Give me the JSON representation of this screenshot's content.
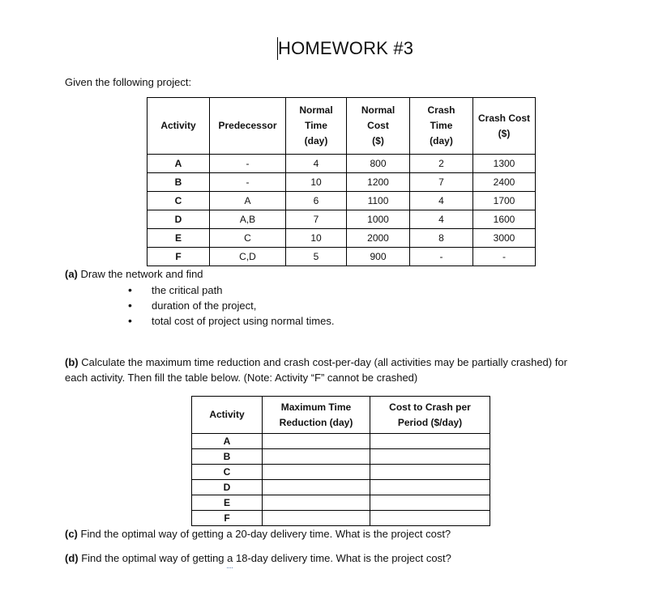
{
  "document": {
    "title": "HOMEWORK #3",
    "intro": "Given the following project:"
  },
  "project_table": {
    "headers": [
      "Activity",
      "Predecessor",
      "Normal Time (day)",
      "Normal Cost ($)",
      "Crash Time (day)",
      "Crash Cost ($)"
    ],
    "header_lines": [
      [
        "Activity"
      ],
      [
        "Predecessor"
      ],
      [
        "Normal",
        "Time",
        "(day)"
      ],
      [
        "Normal",
        "Cost",
        "($)"
      ],
      [
        "Crash",
        "Time",
        "(day)"
      ],
      [
        "Crash Cost",
        "($)"
      ]
    ],
    "rows": [
      {
        "activity": "A",
        "predecessor": "-",
        "normal_time": "4",
        "normal_cost": "800",
        "crash_time": "2",
        "crash_cost": "1300"
      },
      {
        "activity": "B",
        "predecessor": "-",
        "normal_time": "10",
        "normal_cost": "1200",
        "crash_time": "7",
        "crash_cost": "2400"
      },
      {
        "activity": "C",
        "predecessor": "A",
        "normal_time": "6",
        "normal_cost": "1100",
        "crash_time": "4",
        "crash_cost": "1700"
      },
      {
        "activity": "D",
        "predecessor": "A,B",
        "normal_time": "7",
        "normal_cost": "1000",
        "crash_time": "4",
        "crash_cost": "1600"
      },
      {
        "activity": "E",
        "predecessor": "C",
        "normal_time": "10",
        "normal_cost": "2000",
        "crash_time": "8",
        "crash_cost": "3000"
      },
      {
        "activity": "F",
        "predecessor": "C,D",
        "normal_time": "5",
        "normal_cost": "900",
        "crash_time": "-",
        "crash_cost": "-"
      }
    ]
  },
  "part_a": {
    "label": "(a)",
    "text": " Draw the network and find",
    "bullets": [
      "the critical path",
      "duration of the project,",
      "total cost of project using normal times."
    ]
  },
  "part_b": {
    "label": "(b)",
    "line1": " Calculate the maximum time reduction and crash cost-per-day (all activities may be partially crashed) for",
    "line2": "each activity. Then fill the table below. (Note: Activity “F” cannot be crashed)"
  },
  "crash_table": {
    "headers": {
      "activity": "Activity",
      "max_reduction_1": "Maximum Time",
      "max_reduction_2": "Reduction (day)",
      "cost_1": "Cost to Crash per",
      "cost_2": "Period ($/day)"
    },
    "rows": [
      {
        "activity": "A",
        "max_reduction": "",
        "cost_per_day": ""
      },
      {
        "activity": "B",
        "max_reduction": "",
        "cost_per_day": ""
      },
      {
        "activity": "C",
        "max_reduction": "",
        "cost_per_day": ""
      },
      {
        "activity": "D",
        "max_reduction": "",
        "cost_per_day": ""
      },
      {
        "activity": "E",
        "max_reduction": "",
        "cost_per_day": ""
      },
      {
        "activity": "F",
        "max_reduction": "",
        "cost_per_day": ""
      }
    ]
  },
  "part_c": {
    "label": "(c)",
    "text": " Find the optimal way of getting a 20-day delivery time. What is the project cost?"
  },
  "part_d": {
    "label": "(d)",
    "text_before": " Find the optimal way of getting ",
    "text_flagged": "a",
    "text_after": " 18-day delivery time. What is the project cost?"
  }
}
